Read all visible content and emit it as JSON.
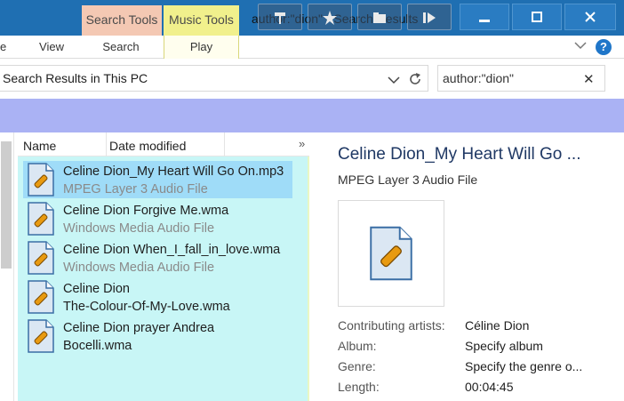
{
  "window": {
    "title": "author:\"dion\" - Search Results"
  },
  "context_tabs": {
    "search_tools": "Search Tools",
    "music_tools": "Music Tools"
  },
  "ribbon": {
    "tabs": [
      "View",
      "Search",
      "Play"
    ],
    "partial_tab": "e"
  },
  "address": {
    "path": "Search Results in This PC"
  },
  "search": {
    "query": "author:\"dion\"",
    "clear_glyph": "✕"
  },
  "columns": {
    "name": "Name",
    "date_modified": "Date modified",
    "more": "»"
  },
  "files": [
    {
      "line1": "Celine Dion_My Heart Will Go On.mp3",
      "line2": "MPEG Layer 3 Audio File",
      "selected": true
    },
    {
      "line1": "Celine Dion Forgive Me.wma",
      "line2": "Windows Media Audio File",
      "selected": false
    },
    {
      "line1": "Celine Dion When_I_fall_in_love.wma",
      "line2": "Windows Media Audio File",
      "selected": false
    },
    {
      "line1": "Celine Dion",
      "line2": "The-Colour-Of-My-Love.wma",
      "selected": false
    },
    {
      "line1": "Celine Dion prayer Andrea",
      "line2": "Bocelli.wma",
      "selected": false
    }
  ],
  "details": {
    "title": "Celine Dion_My Heart Will Go ...",
    "type": "MPEG Layer 3 Audio File",
    "properties": [
      {
        "label": "Contributing artists:",
        "value": "Céline Dion"
      },
      {
        "label": "Album:",
        "value": "Specify album"
      },
      {
        "label": "Genre:",
        "value": "Specify the genre o..."
      },
      {
        "label": "Length:",
        "value": "00:04:45"
      }
    ]
  },
  "icons": {
    "file": "media-file-icon",
    "help": "help-icon"
  },
  "colors": {
    "title_bar": "#1f6fb2",
    "search_tools_tab": "#f4c8b3",
    "music_tools_tab": "#f1f08c",
    "progress_band": "#aab2f4",
    "file_list_bg": "#c8f6f6",
    "selection": "#9fdcf8"
  }
}
